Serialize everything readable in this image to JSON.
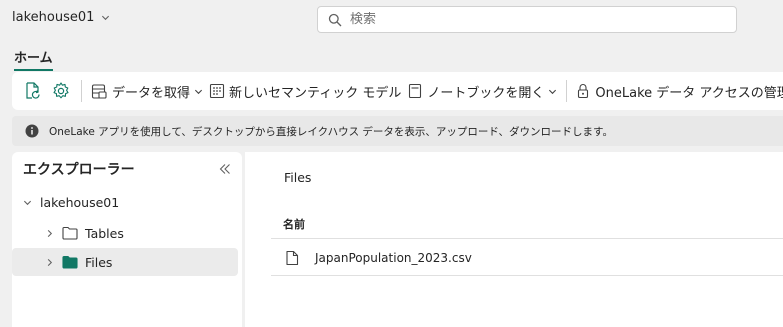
{
  "topbar": {
    "workspace_name": "lakehouse01",
    "search_placeholder": "検索"
  },
  "tabs": [
    {
      "label": "ホーム",
      "active": true
    }
  ],
  "ribbon": {
    "items": [
      {
        "label": "データを取得",
        "has_dropdown": true
      },
      {
        "label": "新しいセマンティック モデル",
        "has_dropdown": false
      },
      {
        "label": "ノートブックを開く",
        "has_dropdown": true
      },
      {
        "label": "OneLake データ アクセスの管理",
        "has_dropdown": false
      }
    ]
  },
  "info": {
    "message": "OneLake アプリを使用して、デスクトップから直接レイクハウス データを表示、アップロード、ダウンロードします。"
  },
  "explorer": {
    "title": "エクスプローラー",
    "root": "lakehouse01",
    "items": [
      {
        "label": "Tables",
        "selected": false
      },
      {
        "label": "Files",
        "selected": true
      }
    ]
  },
  "main": {
    "breadcrumb": "Files",
    "column_header": "名前",
    "files": [
      {
        "name": "JapanPopulation_2023.csv"
      }
    ]
  },
  "colors": {
    "accent": "#117865",
    "background": "#f0f0f0",
    "panel": "#ffffff",
    "selected_row": "#ebebeb"
  }
}
